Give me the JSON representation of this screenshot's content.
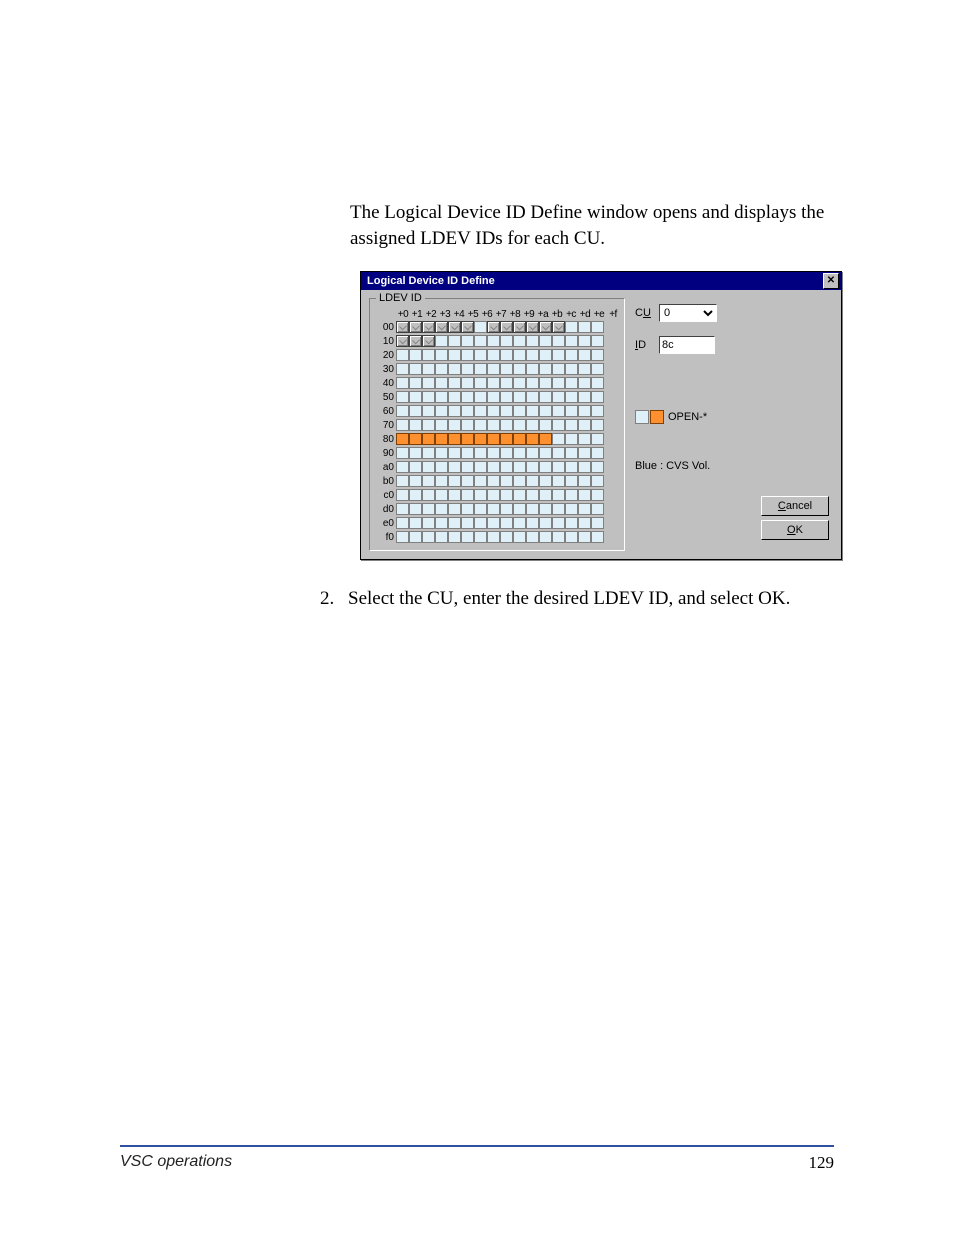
{
  "intro_text": "The Logical Device ID Define window opens and displays the assigned LDEV IDs for each CU.",
  "dialog": {
    "title": "Logical Device ID Define",
    "groupbox_label": "LDEV ID",
    "col_headers": [
      "+0",
      "+1",
      "+2",
      "+3",
      "+4",
      "+5",
      "+6",
      "+7",
      "+8",
      "+9",
      "+a",
      "+b",
      "+c",
      "+d",
      "+e",
      "+f"
    ],
    "rows": [
      {
        "label": "00",
        "cells": [
          "used",
          "used",
          "used",
          "used",
          "used",
          "used",
          "empty",
          "used",
          "used",
          "used",
          "used",
          "used",
          "used",
          "empty",
          "empty",
          "empty"
        ]
      },
      {
        "label": "10",
        "cells": [
          "used",
          "used",
          "used",
          "empty",
          "empty",
          "empty",
          "empty",
          "empty",
          "empty",
          "empty",
          "empty",
          "empty",
          "empty",
          "empty",
          "empty",
          "empty"
        ]
      },
      {
        "label": "20",
        "cells": [
          "empty",
          "empty",
          "empty",
          "empty",
          "empty",
          "empty",
          "empty",
          "empty",
          "empty",
          "empty",
          "empty",
          "empty",
          "empty",
          "empty",
          "empty",
          "empty"
        ]
      },
      {
        "label": "30",
        "cells": [
          "empty",
          "empty",
          "empty",
          "empty",
          "empty",
          "empty",
          "empty",
          "empty",
          "empty",
          "empty",
          "empty",
          "empty",
          "empty",
          "empty",
          "empty",
          "empty"
        ]
      },
      {
        "label": "40",
        "cells": [
          "empty",
          "empty",
          "empty",
          "empty",
          "empty",
          "empty",
          "empty",
          "empty",
          "empty",
          "empty",
          "empty",
          "empty",
          "empty",
          "empty",
          "empty",
          "empty"
        ]
      },
      {
        "label": "50",
        "cells": [
          "empty",
          "empty",
          "empty",
          "empty",
          "empty",
          "empty",
          "empty",
          "empty",
          "empty",
          "empty",
          "empty",
          "empty",
          "empty",
          "empty",
          "empty",
          "empty"
        ]
      },
      {
        "label": "60",
        "cells": [
          "empty",
          "empty",
          "empty",
          "empty",
          "empty",
          "empty",
          "empty",
          "empty",
          "empty",
          "empty",
          "empty",
          "empty",
          "empty",
          "empty",
          "empty",
          "empty"
        ]
      },
      {
        "label": "70",
        "cells": [
          "empty",
          "empty",
          "empty",
          "empty",
          "empty",
          "empty",
          "empty",
          "empty",
          "empty",
          "empty",
          "empty",
          "empty",
          "empty",
          "empty",
          "empty",
          "empty"
        ]
      },
      {
        "label": "80",
        "cells": [
          "marked",
          "marked",
          "marked",
          "marked",
          "marked",
          "marked",
          "marked",
          "marked",
          "marked",
          "marked",
          "marked",
          "marked",
          "empty",
          "empty",
          "empty",
          "empty"
        ]
      },
      {
        "label": "90",
        "cells": [
          "empty",
          "empty",
          "empty",
          "empty",
          "empty",
          "empty",
          "empty",
          "empty",
          "empty",
          "empty",
          "empty",
          "empty",
          "empty",
          "empty",
          "empty",
          "empty"
        ]
      },
      {
        "label": "a0",
        "cells": [
          "empty",
          "empty",
          "empty",
          "empty",
          "empty",
          "empty",
          "empty",
          "empty",
          "empty",
          "empty",
          "empty",
          "empty",
          "empty",
          "empty",
          "empty",
          "empty"
        ]
      },
      {
        "label": "b0",
        "cells": [
          "empty",
          "empty",
          "empty",
          "empty",
          "empty",
          "empty",
          "empty",
          "empty",
          "empty",
          "empty",
          "empty",
          "empty",
          "empty",
          "empty",
          "empty",
          "empty"
        ]
      },
      {
        "label": "c0",
        "cells": [
          "empty",
          "empty",
          "empty",
          "empty",
          "empty",
          "empty",
          "empty",
          "empty",
          "empty",
          "empty",
          "empty",
          "empty",
          "empty",
          "empty",
          "empty",
          "empty"
        ]
      },
      {
        "label": "d0",
        "cells": [
          "empty",
          "empty",
          "empty",
          "empty",
          "empty",
          "empty",
          "empty",
          "empty",
          "empty",
          "empty",
          "empty",
          "empty",
          "empty",
          "empty",
          "empty",
          "empty"
        ]
      },
      {
        "label": "e0",
        "cells": [
          "empty",
          "empty",
          "empty",
          "empty",
          "empty",
          "empty",
          "empty",
          "empty",
          "empty",
          "empty",
          "empty",
          "empty",
          "empty",
          "empty",
          "empty",
          "empty"
        ]
      },
      {
        "label": "f0",
        "cells": [
          "empty",
          "empty",
          "empty",
          "empty",
          "empty",
          "empty",
          "empty",
          "empty",
          "empty",
          "empty",
          "empty",
          "empty",
          "empty",
          "empty",
          "empty",
          "empty"
        ]
      }
    ],
    "cu_label": "CU",
    "cu_value": "0",
    "id_label": "ID",
    "id_value": "8c",
    "legend_text": "OPEN-*",
    "cvs_note": "Blue : CVS Vol.",
    "cancel_label": "Cancel",
    "ok_label": "OK"
  },
  "step": {
    "number": "2.",
    "text": "Select the CU, enter the desired LDEV ID, and select OK."
  },
  "footer": {
    "left": "VSC operations",
    "right": "129"
  }
}
